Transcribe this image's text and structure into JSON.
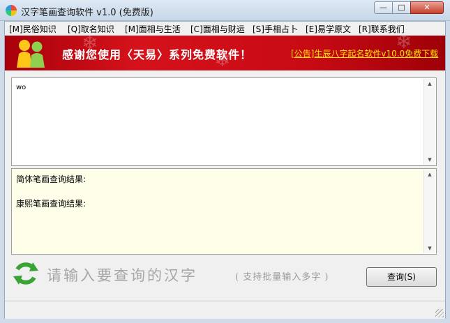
{
  "window": {
    "title": "汉字笔画查询软件 v1.0 (免费版)",
    "min_glyph": "—",
    "max_glyph": "□",
    "close_glyph": "✕"
  },
  "menu": [
    {
      "label": "[M]民俗知识"
    },
    {
      "label": "[Q]取名知识"
    },
    {
      "label": "[M]面相与生活"
    },
    {
      "label": "[C]面相与财运"
    },
    {
      "label": "[S]手相占卜"
    },
    {
      "label": "[E]易学原文"
    },
    {
      "label": "[R]联系我们"
    }
  ],
  "banner": {
    "text": "感谢您使用〈天易〉系列免费软件！",
    "link": "[公告]生辰八字起名软件v10.0免费下载"
  },
  "input": {
    "value": "wo"
  },
  "results": {
    "simplified_label": "简体笔画查询结果:",
    "kangxi_label": "康熙笔画查询结果:"
  },
  "prompt": {
    "main": "请输入要查询的汉字",
    "hint": "( 支持批量输入多字 )"
  },
  "query_button": {
    "label": "查询(S)"
  },
  "colors": {
    "banner_red": "#d5121b",
    "banner_link": "#ffe600",
    "result_bg": "#fefee9",
    "prompt_gray": "#a6a6a6",
    "refresh_green": "#3aa335"
  },
  "icons": {
    "app": "app-icon",
    "banner": "people-icon",
    "prompt": "refresh-icon"
  }
}
